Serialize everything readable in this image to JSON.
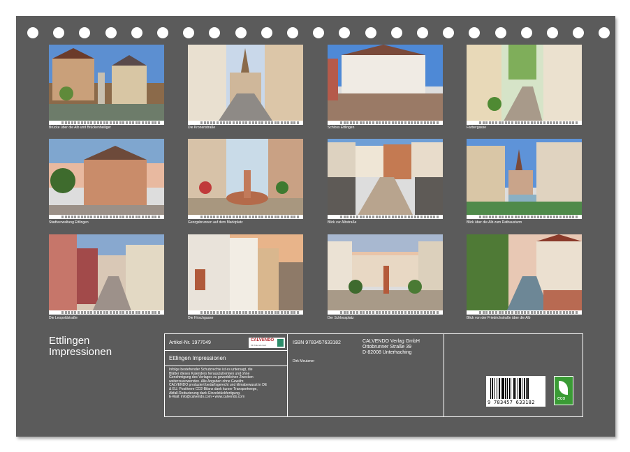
{
  "calendar": {
    "title_line1": "Ettlingen",
    "title_line2": "Impressionen"
  },
  "photos": [
    {
      "caption": "Brücke über die Alb und Brückenheiliger"
    },
    {
      "caption": "Die Kronenstraße"
    },
    {
      "caption": "Schloss Ettlingen"
    },
    {
      "caption": "Färbergasse"
    },
    {
      "caption": "Stadtverwaltung Ettlingen"
    },
    {
      "caption": "Georgsbrunnen auf dem Marktplatz"
    },
    {
      "caption": "Blick zur Albstraße"
    },
    {
      "caption": "Blick über die Alb zum Rathausturm"
    },
    {
      "caption": "Die Leopoldstraße"
    },
    {
      "caption": "Die Hirschgasse"
    },
    {
      "caption": "Der Schlossplatz"
    },
    {
      "caption": "Blick von der Friedrichstraße über die Alb"
    }
  ],
  "info": {
    "article": "Artikel-Nr. 1977049",
    "logo_text": "CALVENDO",
    "logo_sub": "Mit Kalenderwelt",
    "product_title": "Ettlingen Impressionen",
    "legal": [
      "Infolge bestehender Schutzrechte ist es untersagt, die",
      "Blätter dieses Kalenders herauszutrennen und ohne",
      "Genehmigung des Verlages zu gewerblichen Zwecken",
      "weiterzuverwenden. Alle Angaben ohne Gewähr.",
      "CALVENDO produziert bedarfsgerecht und klimabewusst in DE",
      "& EU. Positivere CO2-Bilanz dank kurzer Transportwege,",
      "Abfall-Reduzierung dank Einzelstückfertigung.",
      "E-Mail: info@calvendo.com • www.calvendo.com"
    ],
    "isbn": "ISBN 9783457633182",
    "author": "Dirk Meutzner",
    "publisher_name": "CALVENDO Verlag GmbH",
    "publisher_street": "Ottobrunner Straße 39",
    "publisher_city": "D-82008 Unterhaching",
    "barcode_number": "9 783457 633182",
    "eco_label": "eco"
  },
  "colors": {
    "board": "#5b5b5b",
    "eco_green": "#3a9b35",
    "logo_red": "#b2252b"
  }
}
